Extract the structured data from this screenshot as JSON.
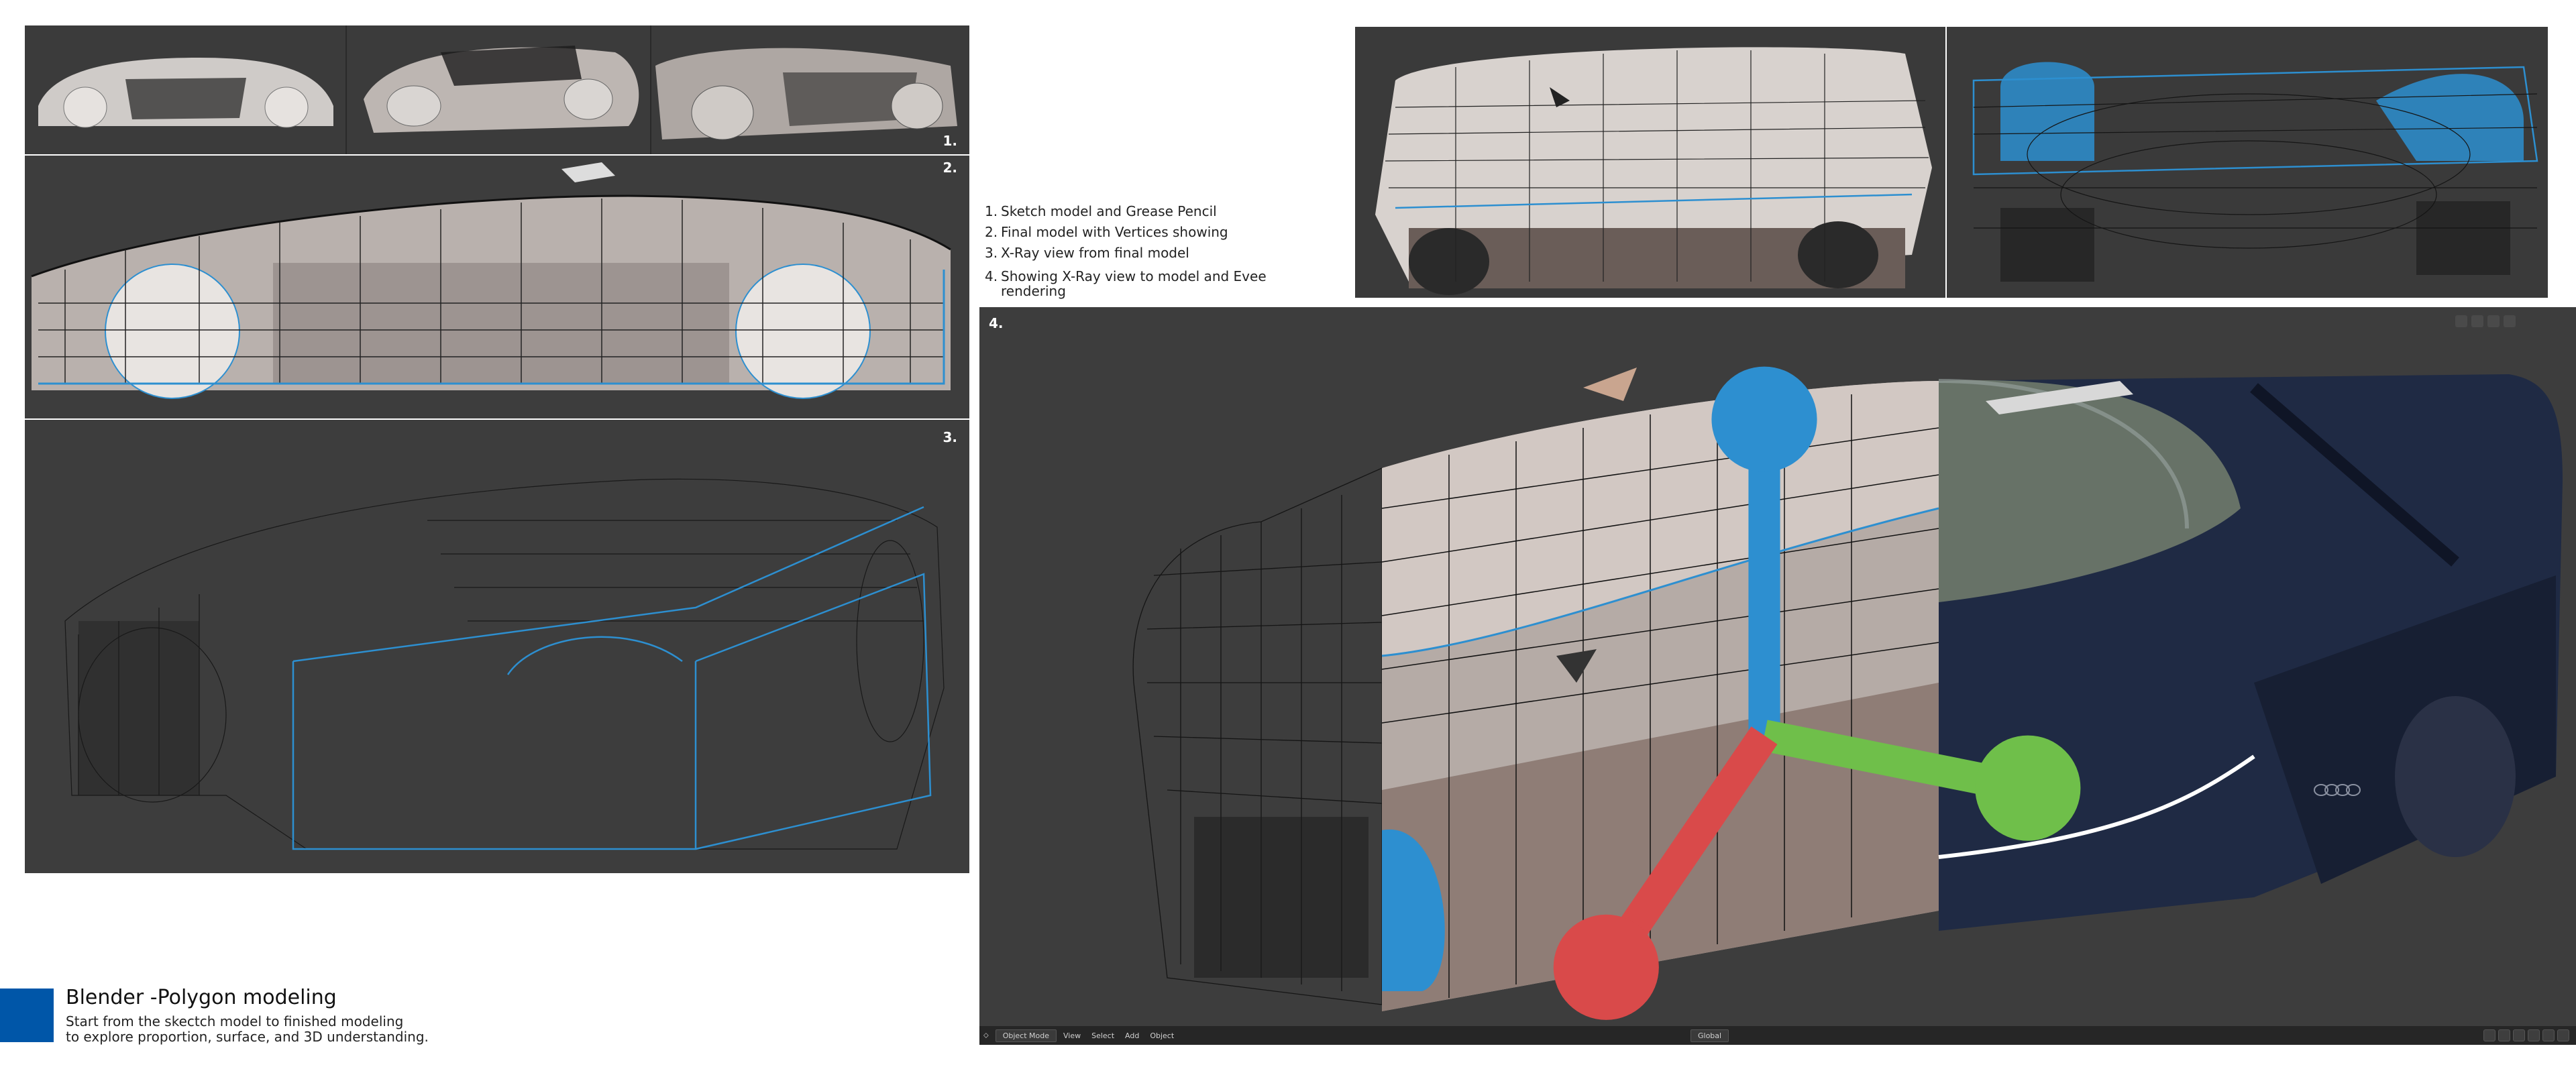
{
  "panels": {
    "p1": {
      "label": "1."
    },
    "p2": {
      "label": "2."
    },
    "p3": {
      "label": "3."
    },
    "p4": {
      "label": "4."
    }
  },
  "legend": {
    "items": [
      {
        "num": "1.",
        "text": "Sketch model and Grease Pencil"
      },
      {
        "num": "2.",
        "text": "Final model with Vertices showing"
      },
      {
        "num": "3.",
        "text": "X-Ray view from final model"
      },
      {
        "num": "4.",
        "text": "Showing X-Ray view to model and Evee rendering"
      }
    ]
  },
  "footer": {
    "title": "Blender -Polygon modeling",
    "subtitle_line1": "Start from the skectch model to finished modeling",
    "subtitle_line2": "to explore proportion, surface, and 3D understanding."
  },
  "viewport": {
    "mode": "Object Mode",
    "menu": [
      "View",
      "Select",
      "Add",
      "Object"
    ],
    "orientation": "Global"
  },
  "colors": {
    "accent": "#0056a8",
    "viewport_bg": "#3d3d3d",
    "wire_blue": "#2d8fd0",
    "car_dark": "#1f2a44"
  },
  "icons": [
    "gizmo-axes-icon",
    "cursor-icon",
    "status-icons"
  ]
}
